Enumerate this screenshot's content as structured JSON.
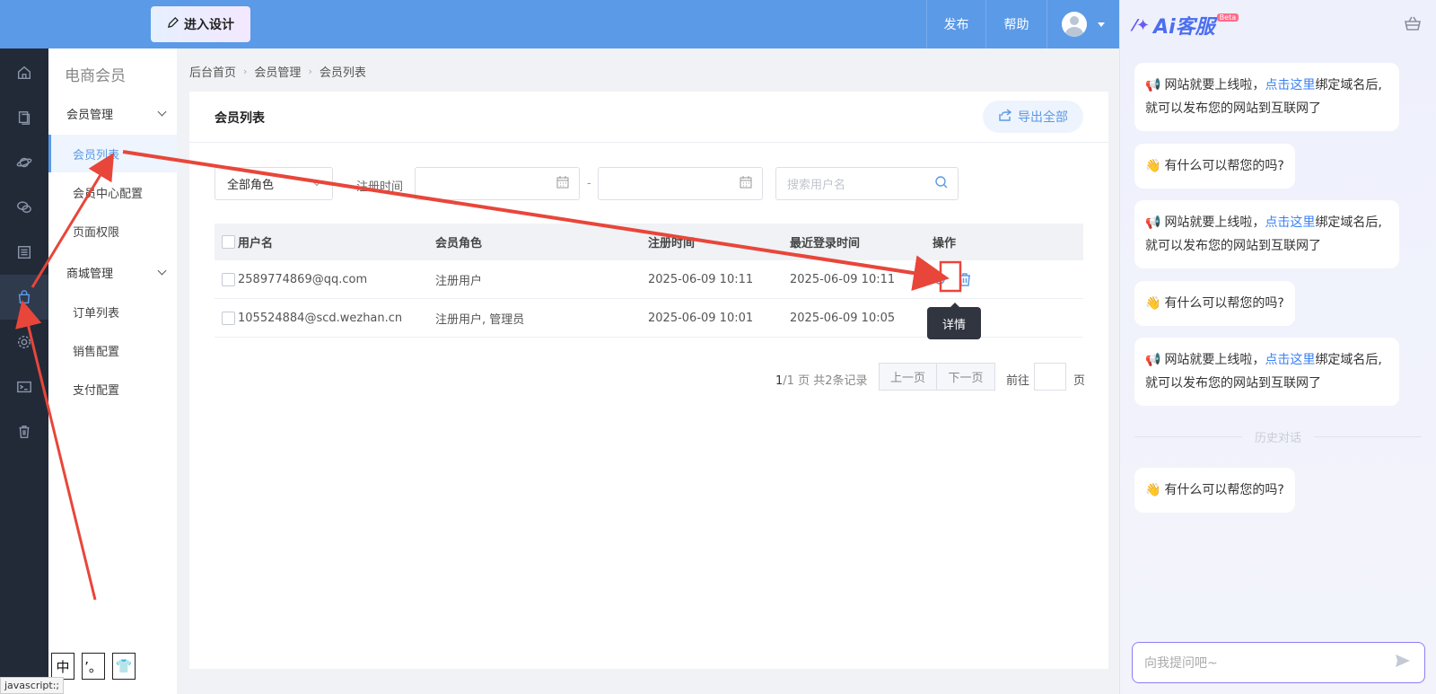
{
  "header": {
    "design_label": "进入设计",
    "publish_label": "发布",
    "help_label": "帮助"
  },
  "rail": {
    "icons": [
      "home-icon",
      "pages-icon",
      "planet-icon",
      "chat-icon",
      "list-icon",
      "shopping-bag-icon",
      "gear-icon",
      "terminal-icon",
      "trash-icon"
    ],
    "active_index": 5
  },
  "sidebar": {
    "title": "电商会员",
    "groups": [
      {
        "label": "会员管理",
        "items": [
          "会员列表",
          "会员中心配置",
          "页面权限"
        ]
      },
      {
        "label": "商城管理",
        "items": [
          "订单列表",
          "销售配置",
          "支付配置"
        ]
      }
    ],
    "active_item": "会员列表"
  },
  "breadcrumb": [
    "后台首页",
    "会员管理",
    "会员列表"
  ],
  "card": {
    "title": "会员列表",
    "export_label": "导出全部"
  },
  "filters": {
    "role_value": "全部角色",
    "reg_label": "注册时间",
    "date_separator": "-",
    "search_placeholder": "搜索用户名"
  },
  "table": {
    "headers": [
      "用户名",
      "会员角色",
      "注册时间",
      "最近登录时间",
      "操作"
    ],
    "rows": [
      {
        "username": "2589774869@qq.com",
        "role": "注册用户",
        "reg_time": "2025-06-09 10:11",
        "last_login": "2025-06-09 10:11"
      },
      {
        "username": "105524884@scd.wezhan.cn",
        "role": "注册用户, 管理员",
        "reg_time": "2025-06-09 10:01",
        "last_login": "2025-06-09 10:05"
      }
    ]
  },
  "tooltip": "详情",
  "pagination": {
    "current": "1",
    "total_text": "/1 页 共2条记录",
    "prev_label": "上一页",
    "next_label": "下一页",
    "goto_label": "前往",
    "goto_unit": "页"
  },
  "ai_panel": {
    "logo_text": "Ai客服",
    "beta": "Beta",
    "messages": [
      {
        "pre": "网站就要上线啦，",
        "link": "点击这里",
        "post": "绑定域名后,就可以发布您的网站到互联网了"
      },
      {
        "text": "有什么可以帮您的吗?"
      },
      {
        "pre": "网站就要上线啦，",
        "link": "点击这里",
        "post": "绑定域名后,就可以发布您的网站到互联网了"
      },
      {
        "text": "有什么可以帮您的吗?"
      },
      {
        "pre": "网站就要上线啦，",
        "link": "点击这里",
        "post": "绑定域名后,就可以发布您的网站到互联网了"
      }
    ],
    "history_label": "历史对话",
    "last_message": "有什么可以帮您的吗?",
    "input_placeholder": "向我提问吧~"
  },
  "ime": [
    "中",
    "’。",
    "👕"
  ],
  "status_url": "javascript:;",
  "colors": {
    "header": "#5b9ae7",
    "rail": "#222a38",
    "accent": "#5b9ae7",
    "annotation": "#e8463a"
  }
}
